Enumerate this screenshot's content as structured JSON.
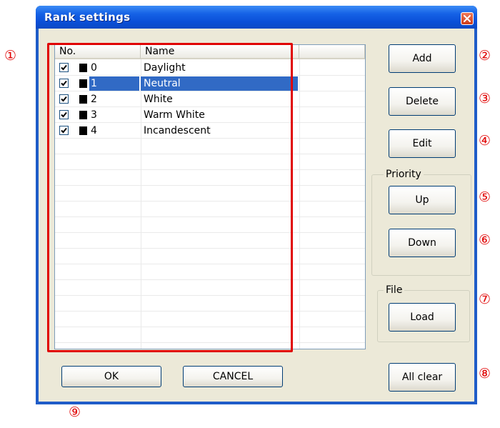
{
  "window": {
    "title": "Rank settings"
  },
  "list": {
    "columns": [
      "No.",
      "Name",
      ""
    ],
    "rows": [
      {
        "checked": true,
        "no": "0",
        "name": "Daylight",
        "selected": false
      },
      {
        "checked": true,
        "no": "1",
        "name": "Neutral",
        "selected": true
      },
      {
        "checked": true,
        "no": "2",
        "name": "White",
        "selected": false
      },
      {
        "checked": true,
        "no": "3",
        "name": "Warm White",
        "selected": false
      },
      {
        "checked": true,
        "no": "4",
        "name": "Incandescent",
        "selected": false
      }
    ]
  },
  "buttons": {
    "add": "Add",
    "delete": "Delete",
    "edit": "Edit",
    "up": "Up",
    "down": "Down",
    "load": "Load",
    "all_clear": "All clear",
    "ok": "OK",
    "cancel": "CANCEL"
  },
  "groups": {
    "priority": "Priority",
    "file": "File"
  },
  "callouts": [
    "①",
    "②",
    "③",
    "④",
    "⑤",
    "⑥",
    "⑦",
    "⑧",
    "⑨"
  ],
  "colors": {
    "title_bar": "#0a4fd8",
    "selection": "#316ac5",
    "callout": "#e00000",
    "dialog_bg": "#ece9d8"
  }
}
